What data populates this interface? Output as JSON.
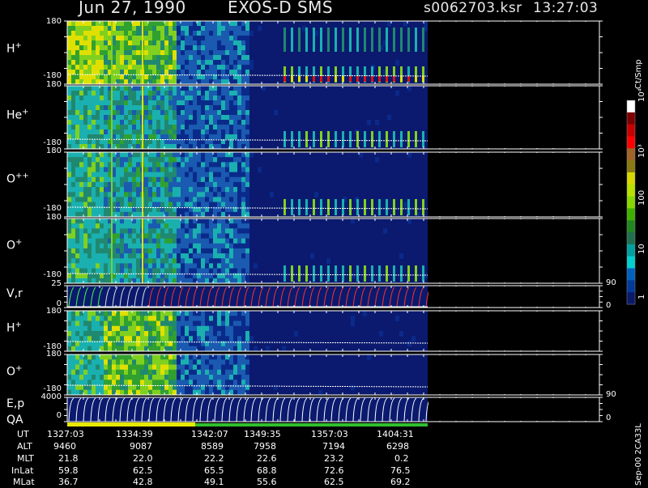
{
  "header": {
    "date": "Jun 27, 1990",
    "instrument": "EXOS-D SMS",
    "file": "s0062703.ksr",
    "time": "13:27:03"
  },
  "panels": [
    {
      "label": "H",
      "sup": "+",
      "ymax": "180",
      "ymin": "-180"
    },
    {
      "label": "He",
      "sup": "+",
      "ymax": "180",
      "ymin": "-180"
    },
    {
      "label": "O",
      "sup": "++",
      "ymax": "180",
      "ymin": "-180"
    },
    {
      "label": "O",
      "sup": "+",
      "ymax": "180",
      "ymin": "-180"
    },
    {
      "label": "V,r",
      "sup": "",
      "ymax": "25",
      "ymin": "0",
      "rmax": "90",
      "rmin": "0"
    },
    {
      "label": "H",
      "sup": "+",
      "ymax": "180",
      "ymin": "-180"
    },
    {
      "label": "O",
      "sup": "+",
      "ymax": "180",
      "ymin": "-180"
    },
    {
      "label": "E,p",
      "sup": "",
      "ymax": "4000",
      "ymin": "0",
      "rmax": "90",
      "rmin": "0"
    }
  ],
  "qa_label": "QA",
  "colorbar": {
    "unit": "Ct/Smp",
    "ticks": [
      "10⁴",
      "10³",
      "100",
      "10",
      "1"
    ],
    "colors": [
      "#ffffff",
      "#800000",
      "#c80000",
      "#ff0000",
      "#a06428",
      "#8a7a10",
      "#d8d800",
      "#b8e000",
      "#88d800",
      "#40b000",
      "#208820",
      "#207050",
      "#00a0a0",
      "#00d0d0",
      "#0060c0",
      "#003a9a",
      "#0a1a6a"
    ]
  },
  "chart_data": {
    "type": "heatmap",
    "title": "Jun 27, 1990   EXOS-D SMS",
    "file": "s0062703.ksr",
    "start_time": "13:27:03",
    "color_scale": "log",
    "color_unit": "Ct/Smp",
    "color_range": [
      1,
      10000
    ],
    "x_rows": [
      {
        "label": "UT",
        "values": [
          "1327:03",
          "1334:39",
          "1342:07",
          "1349:35",
          "1357:03",
          "1404:31"
        ]
      },
      {
        "label": "ALT",
        "values": [
          "9460",
          "9087",
          "8589",
          "7958",
          "7194",
          "6298"
        ]
      },
      {
        "label": "MLT",
        "values": [
          "21.8",
          "22.0",
          "22.2",
          "22.6",
          "23.2",
          "0.2"
        ]
      },
      {
        "label": "InLat",
        "values": [
          "59.8",
          "62.5",
          "65.5",
          "68.8",
          "72.6",
          "76.5"
        ]
      },
      {
        "label": "MLat",
        "values": [
          "36.7",
          "42.8",
          "49.1",
          "55.6",
          "62.5",
          "69.2"
        ]
      }
    ],
    "panels": [
      "H+",
      "He+",
      "O++",
      "O+",
      "V,r",
      "H+",
      "O+",
      "E,p"
    ]
  },
  "footer_code": "Sep-00 2CA33L"
}
